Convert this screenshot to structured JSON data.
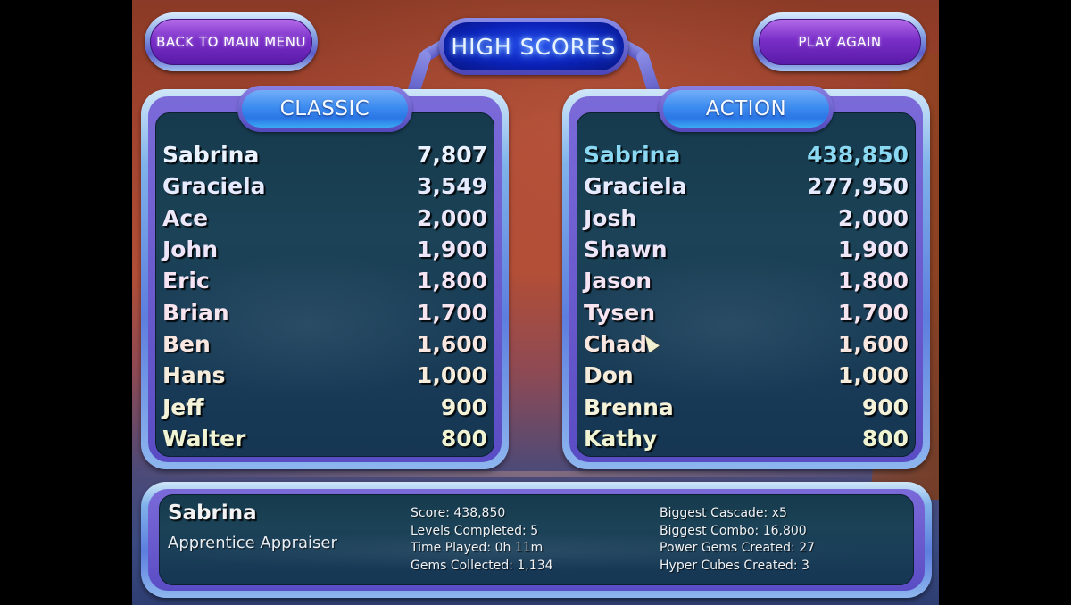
{
  "screen_title": "HIGH SCORES",
  "buttons": {
    "back_to_main_menu": "BACK TO MAIN MENU",
    "play_again": "PLAY AGAIN"
  },
  "boards": [
    {
      "mode": "CLASSIC",
      "entries": [
        {
          "name": "Sabrina",
          "score": "7,807"
        },
        {
          "name": "Graciela",
          "score": "3,549"
        },
        {
          "name": "Ace",
          "score": "2,000"
        },
        {
          "name": "John",
          "score": "1,900"
        },
        {
          "name": "Eric",
          "score": "1,800"
        },
        {
          "name": "Brian",
          "score": "1,700"
        },
        {
          "name": "Ben",
          "score": "1,600"
        },
        {
          "name": "Hans",
          "score": "1,000"
        },
        {
          "name": "Jeff",
          "score": "900"
        },
        {
          "name": "Walter",
          "score": "800"
        }
      ]
    },
    {
      "mode": "ACTION",
      "highlighted_index": 0,
      "entries": [
        {
          "name": "Sabrina",
          "score": "438,850"
        },
        {
          "name": "Graciela",
          "score": "277,950"
        },
        {
          "name": "Josh",
          "score": "2,000"
        },
        {
          "name": "Shawn",
          "score": "1,900"
        },
        {
          "name": "Jason",
          "score": "1,800"
        },
        {
          "name": "Tysen",
          "score": "1,700"
        },
        {
          "name": "Chad",
          "score": "1,600"
        },
        {
          "name": "Don",
          "score": "1,000"
        },
        {
          "name": "Brenna",
          "score": "900"
        },
        {
          "name": "Kathy",
          "score": "800"
        }
      ]
    }
  ],
  "row_colors": [
    "#eaf2ff",
    "#e6eaff",
    "#ece8fa",
    "#eee6f8",
    "#f4e4f4",
    "#f6e4ee",
    "#f8e6e0",
    "#f6ecdc",
    "#f4f2d8",
    "#f0f4d2"
  ],
  "highlight_color": "#8ad8f2",
  "player_stats": {
    "name": "Sabrina",
    "rank": "Apprentice Appraiser",
    "column_1": [
      "Score: 438,850",
      "Levels Completed: 5",
      "Time Played: 0h 11m",
      "Gems Collected: 1,134"
    ],
    "column_2": [
      "Biggest Cascade: x5",
      "Biggest Combo: 16,800",
      "Power Gems Created: 27",
      "Hyper Cubes Created: 3"
    ]
  }
}
